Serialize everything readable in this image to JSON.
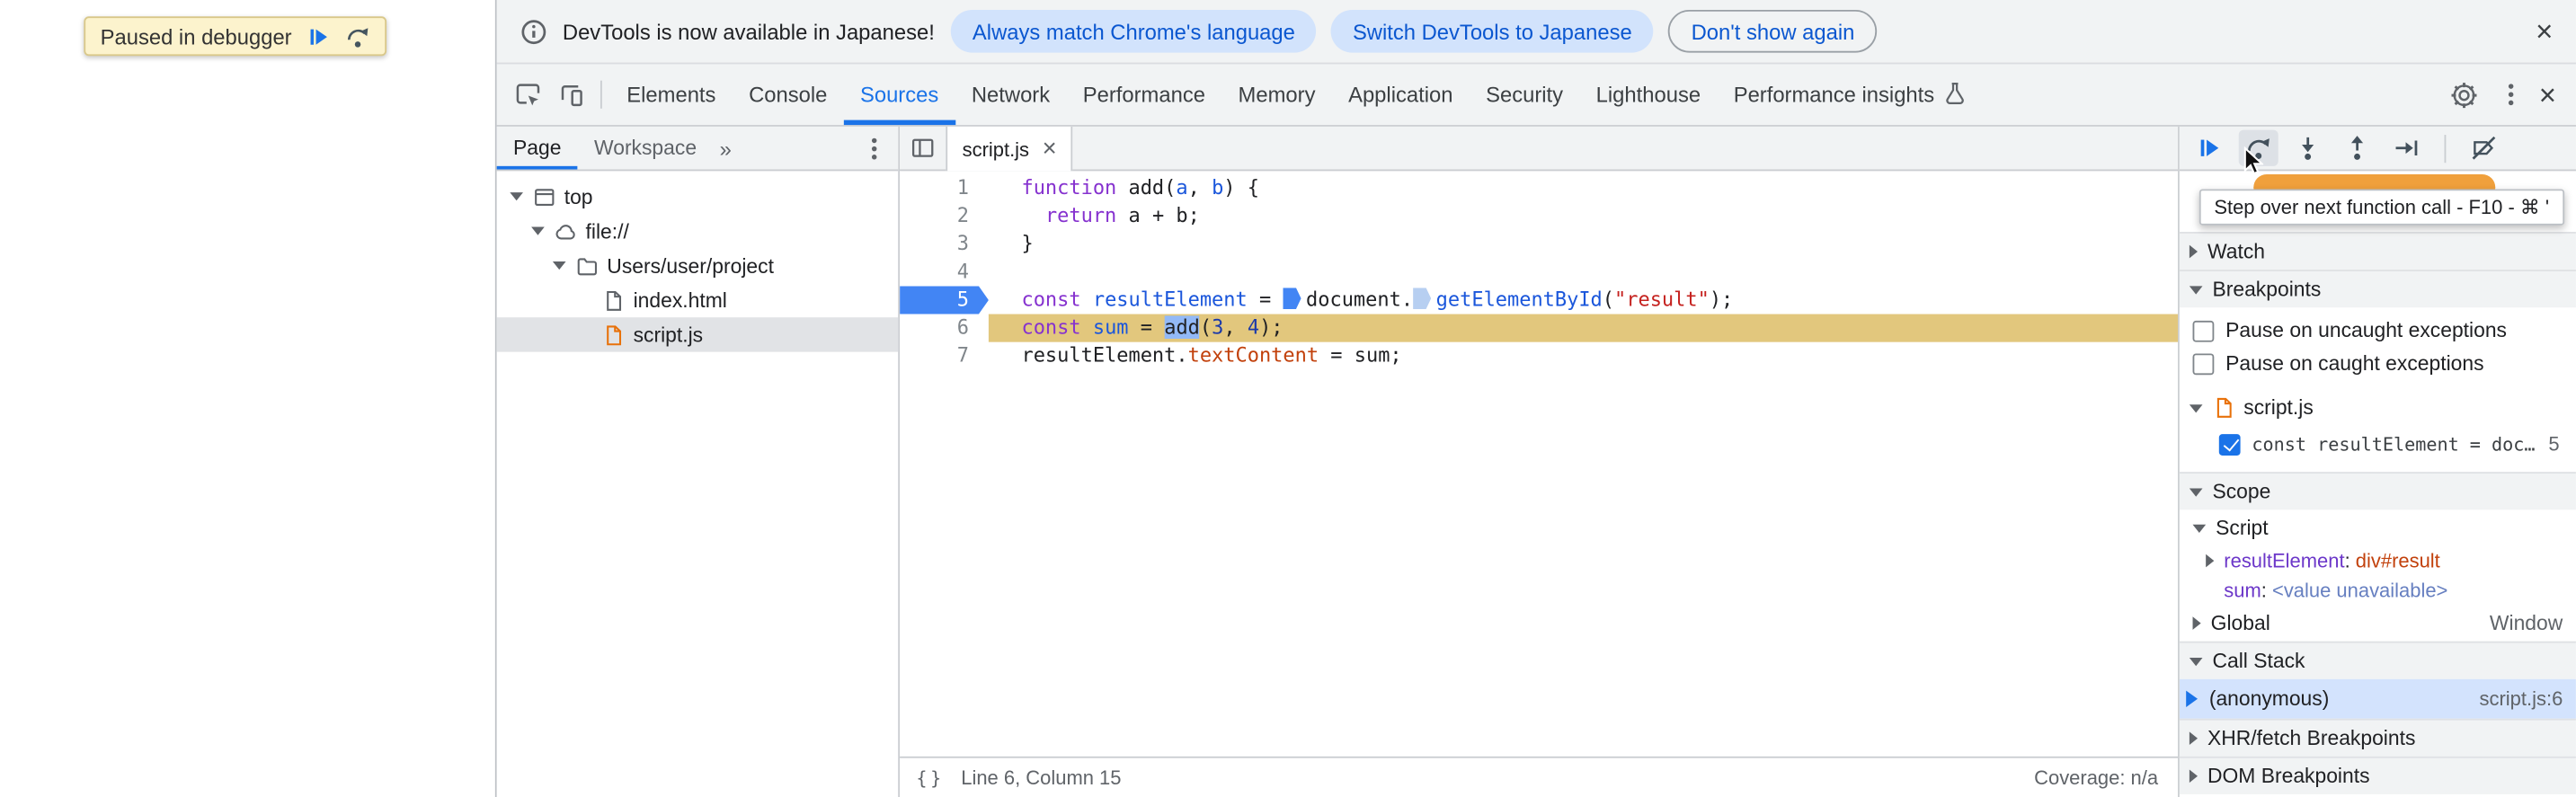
{
  "colors": {
    "accent_blue": "#1a73e8",
    "breakpoint_blue": "#4285f4",
    "execution_line_tan": "#e2c77d",
    "selection_blue": "#92b9f7",
    "paused_toast_orange": "#f0a03c",
    "toolbar_gray": "#f1f3f4",
    "js_file_orange": "#e8710a"
  },
  "icons": {
    "close": "×",
    "overflow": "»"
  },
  "browser_page": {
    "paused_overlay": {
      "label": "Paused in debugger",
      "buttons": [
        {
          "icon": "resume-icon"
        },
        {
          "icon": "step-over-icon"
        }
      ]
    }
  },
  "infobar": {
    "icon": "info-icon",
    "message": "DevTools is now available in Japanese!",
    "buttons": [
      {
        "label": "Always match Chrome's language",
        "variant": "tonal"
      },
      {
        "label": "Switch DevTools to Japanese",
        "variant": "tonal"
      },
      {
        "label": "Don't show again",
        "variant": "outline"
      }
    ],
    "close_glyph": "×"
  },
  "toolbar": {
    "left_icons": [
      "inspect-icon",
      "device-toolbar-icon"
    ],
    "tabs": [
      {
        "label": "Elements",
        "active": false
      },
      {
        "label": "Console",
        "active": false
      },
      {
        "label": "Sources",
        "active": true
      },
      {
        "label": "Network",
        "active": false
      },
      {
        "label": "Performance",
        "active": false
      },
      {
        "label": "Memory",
        "active": false
      },
      {
        "label": "Application",
        "active": false
      },
      {
        "label": "Security",
        "active": false
      },
      {
        "label": "Lighthouse",
        "active": false
      },
      {
        "label": "Performance insights",
        "active": false,
        "trailing_icon": "flask-icon"
      }
    ],
    "right_icons": [
      "gear-icon",
      "kebab-menu-icon",
      "close-icon"
    ]
  },
  "navigator": {
    "tabs": [
      {
        "label": "Page",
        "active": true
      },
      {
        "label": "Workspace",
        "active": false
      }
    ],
    "overflow_glyph": "»",
    "menu_icon": "kebab-menu-icon",
    "tree": [
      {
        "label": "top",
        "icon": "frame-icon",
        "depth": 0,
        "expanded": true,
        "selected": false
      },
      {
        "label": "file://",
        "icon": "cloud-icon",
        "depth": 1,
        "expanded": true,
        "selected": false
      },
      {
        "label": "Users/user/project",
        "icon": "folder-icon",
        "depth": 2,
        "expanded": true,
        "selected": false
      },
      {
        "label": "index.html",
        "icon": "document-icon",
        "depth": 3,
        "expanded": null,
        "selected": false
      },
      {
        "label": "script.js",
        "icon": "js-document-icon",
        "depth": 3,
        "expanded": null,
        "selected": true
      }
    ]
  },
  "editor": {
    "navigator_toggle_icon": "sidebar-toggle-icon",
    "open_tab": {
      "label": "script.js",
      "close_glyph": "×"
    },
    "code_lines": [
      {
        "number": 1,
        "tokens": [
          {
            "text": "function",
            "type": "keyword"
          },
          {
            "text": " add(",
            "type": "plain"
          },
          {
            "text": "a",
            "type": "def"
          },
          {
            "text": ", ",
            "type": "plain"
          },
          {
            "text": "b",
            "type": "def"
          },
          {
            "text": ") {",
            "type": "plain"
          }
        ]
      },
      {
        "number": 2,
        "tokens": [
          {
            "text": "  ",
            "type": "plain"
          },
          {
            "text": "return",
            "type": "keyword"
          },
          {
            "text": " a + b;",
            "type": "plain"
          }
        ]
      },
      {
        "number": 3,
        "tokens": [
          {
            "text": "}",
            "type": "plain"
          }
        ]
      },
      {
        "number": 4,
        "tokens": []
      },
      {
        "number": 5,
        "breakpoint": true,
        "tokens": [
          {
            "text": "const",
            "type": "keyword"
          },
          {
            "text": " ",
            "type": "plain"
          },
          {
            "text": "resultElement",
            "type": "def"
          },
          {
            "text": " = ",
            "type": "plain"
          },
          {
            "type": "inline-breakpoint-active"
          },
          {
            "text": "document.",
            "type": "plain"
          },
          {
            "type": "inline-breakpoint-candidate"
          },
          {
            "text": "getElementById",
            "type": "function"
          },
          {
            "text": "(",
            "type": "plain"
          },
          {
            "text": "\"result\"",
            "type": "string"
          },
          {
            "text": ");",
            "type": "plain"
          }
        ]
      },
      {
        "number": 6,
        "execution_line": true,
        "tokens": [
          {
            "text": "const",
            "type": "keyword"
          },
          {
            "text": " ",
            "type": "plain"
          },
          {
            "text": "sum",
            "type": "def"
          },
          {
            "text": " = ",
            "type": "plain"
          },
          {
            "text": "add",
            "type": "selected"
          },
          {
            "text": "(",
            "type": "plain"
          },
          {
            "text": "3",
            "type": "number"
          },
          {
            "text": ", ",
            "type": "plain"
          },
          {
            "text": "4",
            "type": "number"
          },
          {
            "text": ");",
            "type": "plain"
          }
        ]
      },
      {
        "number": 7,
        "tokens": [
          {
            "text": "resultElement.",
            "type": "plain"
          },
          {
            "text": "textContent",
            "type": "property"
          },
          {
            "text": " = sum;",
            "type": "plain"
          }
        ]
      }
    ],
    "status_bar": {
      "pretty_print_glyph": "{}",
      "position": "Line 6, Column 15",
      "coverage": "Coverage: n/a"
    }
  },
  "debugger": {
    "controls": [
      {
        "icon": "resume-icon",
        "primary": true
      },
      {
        "icon": "step-over-icon",
        "hovered": true
      },
      {
        "icon": "step-into-icon"
      },
      {
        "icon": "step-out-icon"
      },
      {
        "icon": "step-icon"
      },
      {
        "icon": "deactivate-breakpoints-icon",
        "separator_before": true
      }
    ],
    "tooltip": "Step over next function call - F10 - ⌘ '",
    "sections": {
      "watch": {
        "label": "Watch",
        "expanded": false
      },
      "breakpoints": {
        "label": "Breakpoints",
        "expanded": true,
        "toggles": [
          {
            "label": "Pause on uncaught exceptions",
            "checked": false
          },
          {
            "label": "Pause on caught exceptions",
            "checked": false
          }
        ],
        "groups": [
          {
            "file": "script.js",
            "icon": "js-document-icon",
            "expanded": true,
            "items": [
              {
                "checked": true,
                "snippet": "const resultElement = doc…",
                "line": "5"
              }
            ]
          }
        ]
      },
      "scope": {
        "label": "Scope",
        "expanded": true,
        "scopes": [
          {
            "name": "Script",
            "expanded": true,
            "variables": [
              {
                "name": "resultElement",
                "sep": ": ",
                "value": "div#result",
                "value_type": "node",
                "expandable": true
              },
              {
                "name": "sum",
                "sep": ": ",
                "value": "<value unavailable>",
                "value_type": "unavailable",
                "expandable": false
              }
            ]
          },
          {
            "name": "Global",
            "expanded": false,
            "value": "Window",
            "variables": []
          }
        ]
      },
      "call_stack": {
        "label": "Call Stack",
        "expanded": true,
        "frames": [
          {
            "name": "(anonymous)",
            "location": "script.js:6",
            "active": true
          }
        ]
      },
      "xhr": {
        "label": "XHR/fetch Breakpoints",
        "expanded": false
      },
      "dom": {
        "label": "DOM Breakpoints",
        "expanded": false
      }
    }
  }
}
